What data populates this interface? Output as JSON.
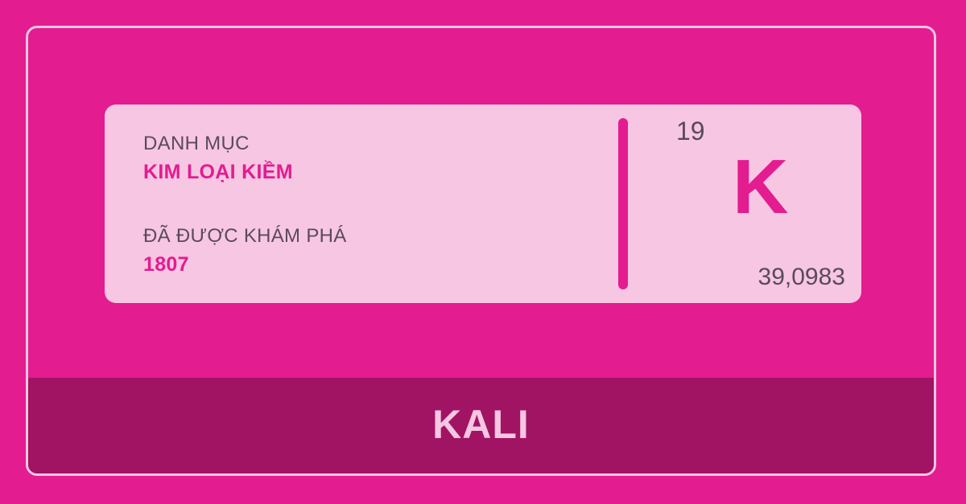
{
  "card": {
    "category_label": "DANH MỤC",
    "category_value": "KIM LOẠI KIỀM",
    "discovered_label": "ĐÃ ĐƯỢC KHÁM PHÁ",
    "discovered_value": "1807",
    "atomic_number": "19",
    "symbol": "K",
    "atomic_mass": "39,0983"
  },
  "footer": {
    "element_name": "KALI"
  },
  "colors": {
    "background": "#e31c90",
    "card": "#f7c6e2",
    "footer": "#a11363",
    "accent": "#e31c90",
    "muted_text": "#5a4a5f"
  }
}
